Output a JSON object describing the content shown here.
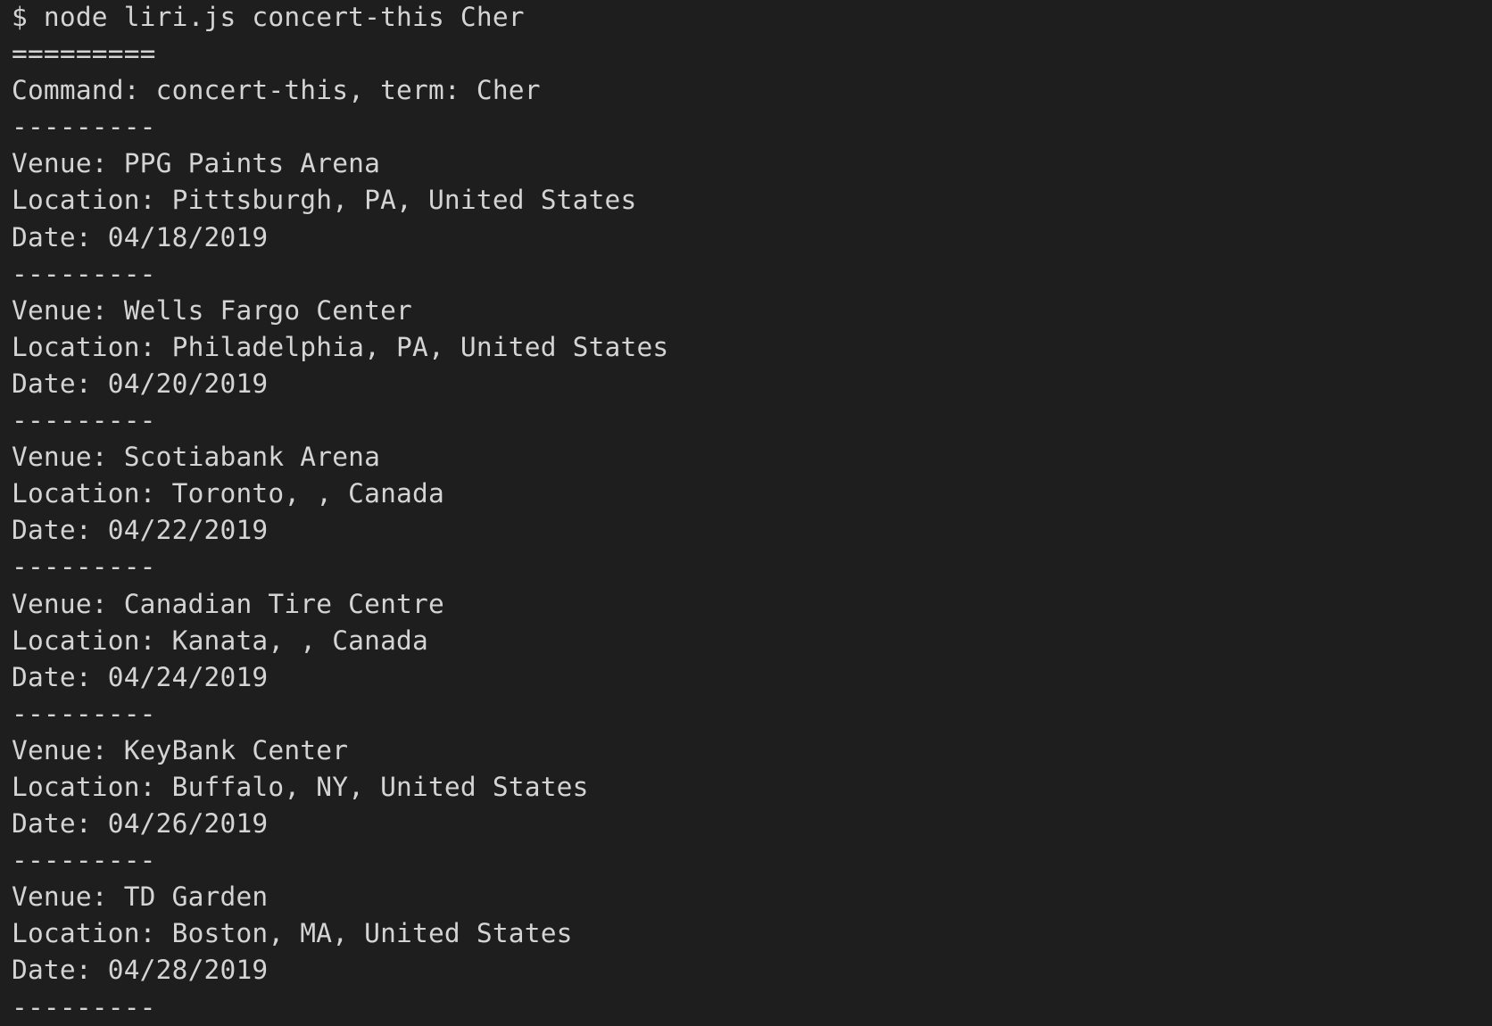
{
  "terminal": {
    "colors": {
      "background": "#1e1e1e",
      "text": "#d4d4d4"
    },
    "prompt_line": "$ node liri.js concert-this Cher",
    "header_rule": "=========",
    "command_line": "Command: concert-this, term: Cher",
    "separator": "---------",
    "events": [
      {
        "venue": "Venue: PPG Paints Arena",
        "location": "Location: Pittsburgh, PA, United States",
        "date": "Date: 04/18/2019"
      },
      {
        "venue": "Venue: Wells Fargo Center",
        "location": "Location: Philadelphia, PA, United States",
        "date": "Date: 04/20/2019"
      },
      {
        "venue": "Venue: Scotiabank Arena",
        "location": "Location: Toronto, , Canada",
        "date": "Date: 04/22/2019"
      },
      {
        "venue": "Venue: Canadian Tire Centre",
        "location": "Location: Kanata, , Canada",
        "date": "Date: 04/24/2019"
      },
      {
        "venue": "Venue: KeyBank Center",
        "location": "Location: Buffalo, NY, United States",
        "date": "Date: 04/26/2019"
      },
      {
        "venue": "Venue: TD Garden",
        "location": "Location: Boston, MA, United States",
        "date": "Date: 04/28/2019"
      }
    ]
  }
}
